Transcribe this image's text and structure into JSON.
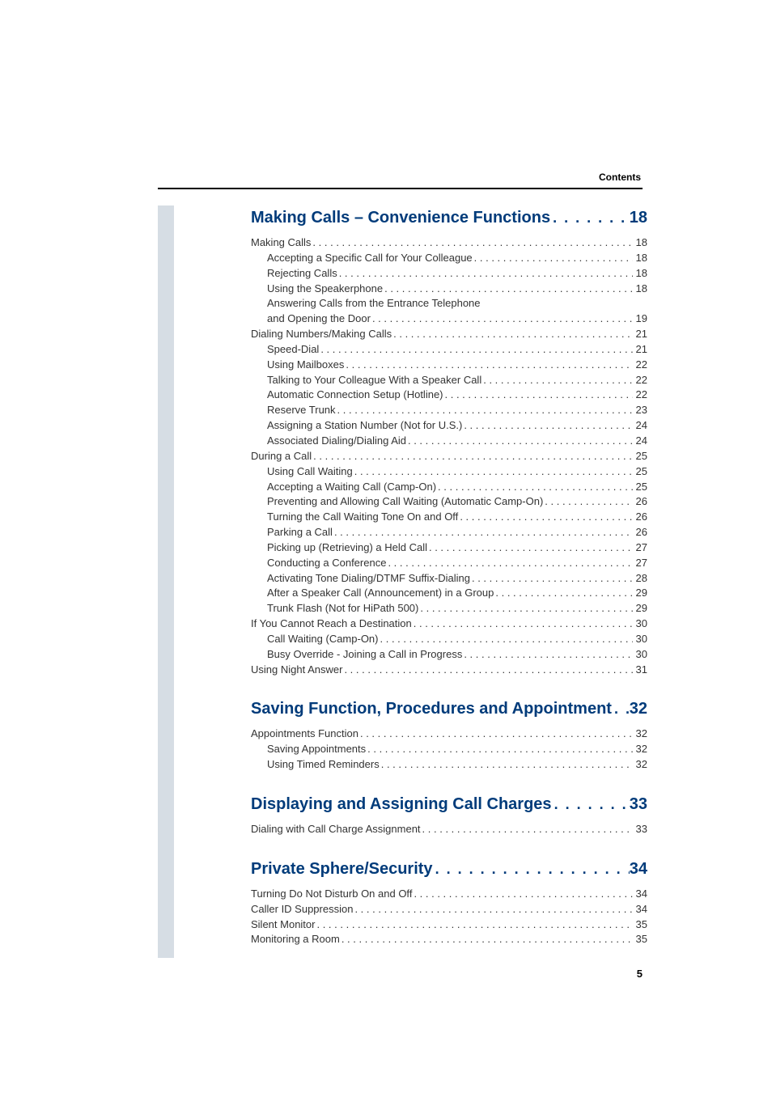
{
  "header": {
    "label": "Contents"
  },
  "page_number": "5",
  "sections": [
    {
      "title": "Making Calls – Convenience Functions",
      "page": "18",
      "entries": [
        {
          "indent": 0,
          "label": "Making Calls",
          "page": "18"
        },
        {
          "indent": 1,
          "label": "Accepting a Specific Call for Your Colleague",
          "page": "18"
        },
        {
          "indent": 1,
          "label": "Rejecting Calls",
          "page": "18"
        },
        {
          "indent": 1,
          "label": "Using the Speakerphone",
          "page": "18"
        },
        {
          "indent": 1,
          "label": "Answering Calls from the Entrance Telephone",
          "page": "",
          "nodots": true
        },
        {
          "indent": 1,
          "label": "and Opening the Door",
          "page": "19"
        },
        {
          "indent": 0,
          "label": "Dialing Numbers/Making Calls",
          "page": "21"
        },
        {
          "indent": 1,
          "label": "Speed-Dial",
          "page": "21"
        },
        {
          "indent": 1,
          "label": "Using Mailboxes",
          "page": "22"
        },
        {
          "indent": 1,
          "label": "Talking to Your Colleague With a Speaker Call",
          "page": "22"
        },
        {
          "indent": 1,
          "label": "Automatic Connection Setup (Hotline)",
          "page": "22"
        },
        {
          "indent": 1,
          "label": "Reserve Trunk",
          "page": "23"
        },
        {
          "indent": 1,
          "label": "Assigning a Station Number (Not for U.S.)",
          "page": "24"
        },
        {
          "indent": 1,
          "label": "Associated Dialing/Dialing Aid",
          "page": "24"
        },
        {
          "indent": 0,
          "label": "During a Call",
          "page": "25"
        },
        {
          "indent": 1,
          "label": "Using Call Waiting",
          "page": "25"
        },
        {
          "indent": 1,
          "label": "Accepting a Waiting Call (Camp-On)",
          "page": "25"
        },
        {
          "indent": 1,
          "label": "Preventing and Allowing Call Waiting (Automatic Camp-On)",
          "page": "26"
        },
        {
          "indent": 1,
          "label": "Turning the Call Waiting Tone On and Off",
          "page": "26"
        },
        {
          "indent": 1,
          "label": "Parking a Call",
          "page": "26"
        },
        {
          "indent": 1,
          "label": "Picking up (Retrieving) a Held Call",
          "page": "27"
        },
        {
          "indent": 1,
          "label": "Conducting a Conference",
          "page": "27"
        },
        {
          "indent": 1,
          "label": "Activating Tone Dialing/DTMF Suffix-Dialing",
          "page": "28"
        },
        {
          "indent": 1,
          "label": "After a Speaker Call (Announcement) in a Group",
          "page": "29"
        },
        {
          "indent": 1,
          "label": "Trunk Flash (Not for HiPath 500)",
          "page": "29"
        },
        {
          "indent": 0,
          "label": "If You Cannot Reach a Destination",
          "page": "30"
        },
        {
          "indent": 1,
          "label": "Call Waiting (Camp-On)",
          "page": "30"
        },
        {
          "indent": 1,
          "label": "Busy Override - Joining a Call in Progress",
          "page": "30"
        },
        {
          "indent": 0,
          "label": "Using Night Answer",
          "page": "31"
        }
      ]
    },
    {
      "title": "Saving Function, Procedures and Appointment",
      "page": "32",
      "entries": [
        {
          "indent": 0,
          "label": "Appointments Function",
          "page": "32"
        },
        {
          "indent": 1,
          "label": "Saving Appointments",
          "page": "32"
        },
        {
          "indent": 1,
          "label": "Using Timed Reminders",
          "page": "32"
        }
      ]
    },
    {
      "title": "Displaying and Assigning Call Charges",
      "page": "33",
      "entries": [
        {
          "indent": 0,
          "label": "Dialing with Call Charge Assignment",
          "page": "33"
        }
      ]
    },
    {
      "title": "Private Sphere/Security",
      "page": "34",
      "entries": [
        {
          "indent": 0,
          "label": "Turning Do Not Disturb On and Off",
          "page": "34"
        },
        {
          "indent": 0,
          "label": "Caller ID Suppression",
          "page": "34"
        },
        {
          "indent": 0,
          "label": "Silent Monitor",
          "page": "35"
        },
        {
          "indent": 0,
          "label": "Monitoring a Room",
          "page": "35"
        }
      ]
    }
  ]
}
